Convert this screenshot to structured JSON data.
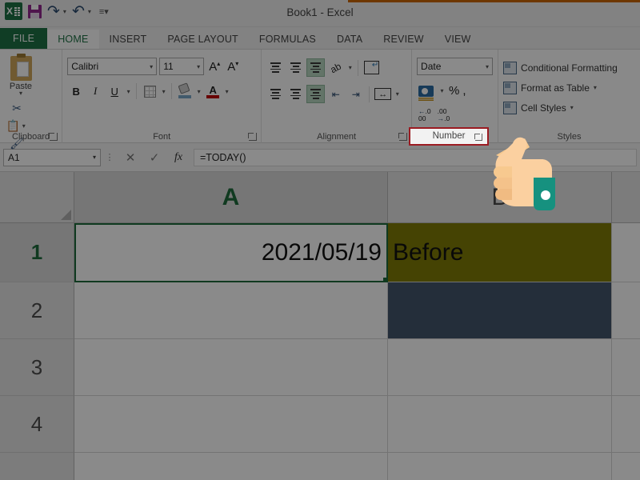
{
  "window": {
    "title": "Book1 - Excel"
  },
  "quick_access": {
    "logo": "excel-logo",
    "items": [
      {
        "name": "save-icon",
        "label": "Save"
      },
      {
        "name": "redo-icon",
        "label": "Redo"
      },
      {
        "name": "undo-icon",
        "label": "Undo"
      },
      {
        "name": "customize-qat-icon",
        "label": "Customize Quick Access Toolbar"
      }
    ]
  },
  "tabs": [
    {
      "label": "FILE",
      "active": false,
      "file": true
    },
    {
      "label": "HOME",
      "active": true
    },
    {
      "label": "INSERT",
      "active": false
    },
    {
      "label": "PAGE LAYOUT",
      "active": false
    },
    {
      "label": "FORMULAS",
      "active": false
    },
    {
      "label": "DATA",
      "active": false
    },
    {
      "label": "REVIEW",
      "active": false
    },
    {
      "label": "VIEW",
      "active": false
    }
  ],
  "ribbon": {
    "clipboard": {
      "group_label": "Clipboard",
      "paste_label": "Paste",
      "cut_icon": "scissors-icon",
      "copy_icon": "copy-icon",
      "format_painter_icon": "format-painter-icon"
    },
    "font": {
      "group_label": "Font",
      "font_name": "Calibri",
      "font_size": "11",
      "grow_font": "A",
      "shrink_font": "A",
      "bold": "B",
      "italic": "I",
      "underline": "U"
    },
    "alignment": {
      "group_label": "Alignment",
      "orientation_icon": "orientation-icon",
      "wrap_text_icon": "wrap-text-icon",
      "merge_center_icon": "merge-and-center-icon",
      "decrease_indent_icon": "decrease-indent-icon",
      "increase_indent_icon": "increase-indent-icon"
    },
    "number": {
      "group_label": "Number",
      "format": "Date",
      "accounting_icon": "accounting-format-icon",
      "percent": "%",
      "comma": ",",
      "increase_decimal": ".00",
      "decrease_decimal": ".0",
      "highlight_color": "#9b1b22"
    },
    "styles": {
      "group_label": "Styles",
      "items": [
        {
          "label": "Conditional Formatting",
          "icon": "conditional-formatting-icon",
          "caret": false
        },
        {
          "label": "Format as Table",
          "icon": "format-as-table-icon",
          "caret": true
        },
        {
          "label": "Cell Styles",
          "icon": "cell-styles-icon",
          "caret": true
        }
      ]
    }
  },
  "formula_bar": {
    "name_box": "A1",
    "cancel_icon": "cancel-icon",
    "enter_icon": "enter-icon",
    "function_icon": "insert-function-icon",
    "formula": "=TODAY()"
  },
  "grid": {
    "columns": [
      {
        "label": "A",
        "selected": true
      },
      {
        "label": "B",
        "selected": false
      }
    ],
    "rows": [
      {
        "label": "1",
        "selected": true
      },
      {
        "label": "2",
        "selected": false
      },
      {
        "label": "3",
        "selected": false
      },
      {
        "label": "4",
        "selected": false
      }
    ],
    "cells": {
      "A1": {
        "value": "2021/05/19",
        "align": "right",
        "selected": true
      },
      "B1": {
        "value": "Before",
        "align": "left",
        "fill": "#807d06"
      },
      "B2": {
        "value": "",
        "align": "left",
        "fill": "#44566b"
      }
    }
  },
  "cursor": {
    "icon": "pointing-hand-cursor",
    "skin_color": "#f7c98f",
    "cuff_color": "#16917f"
  }
}
